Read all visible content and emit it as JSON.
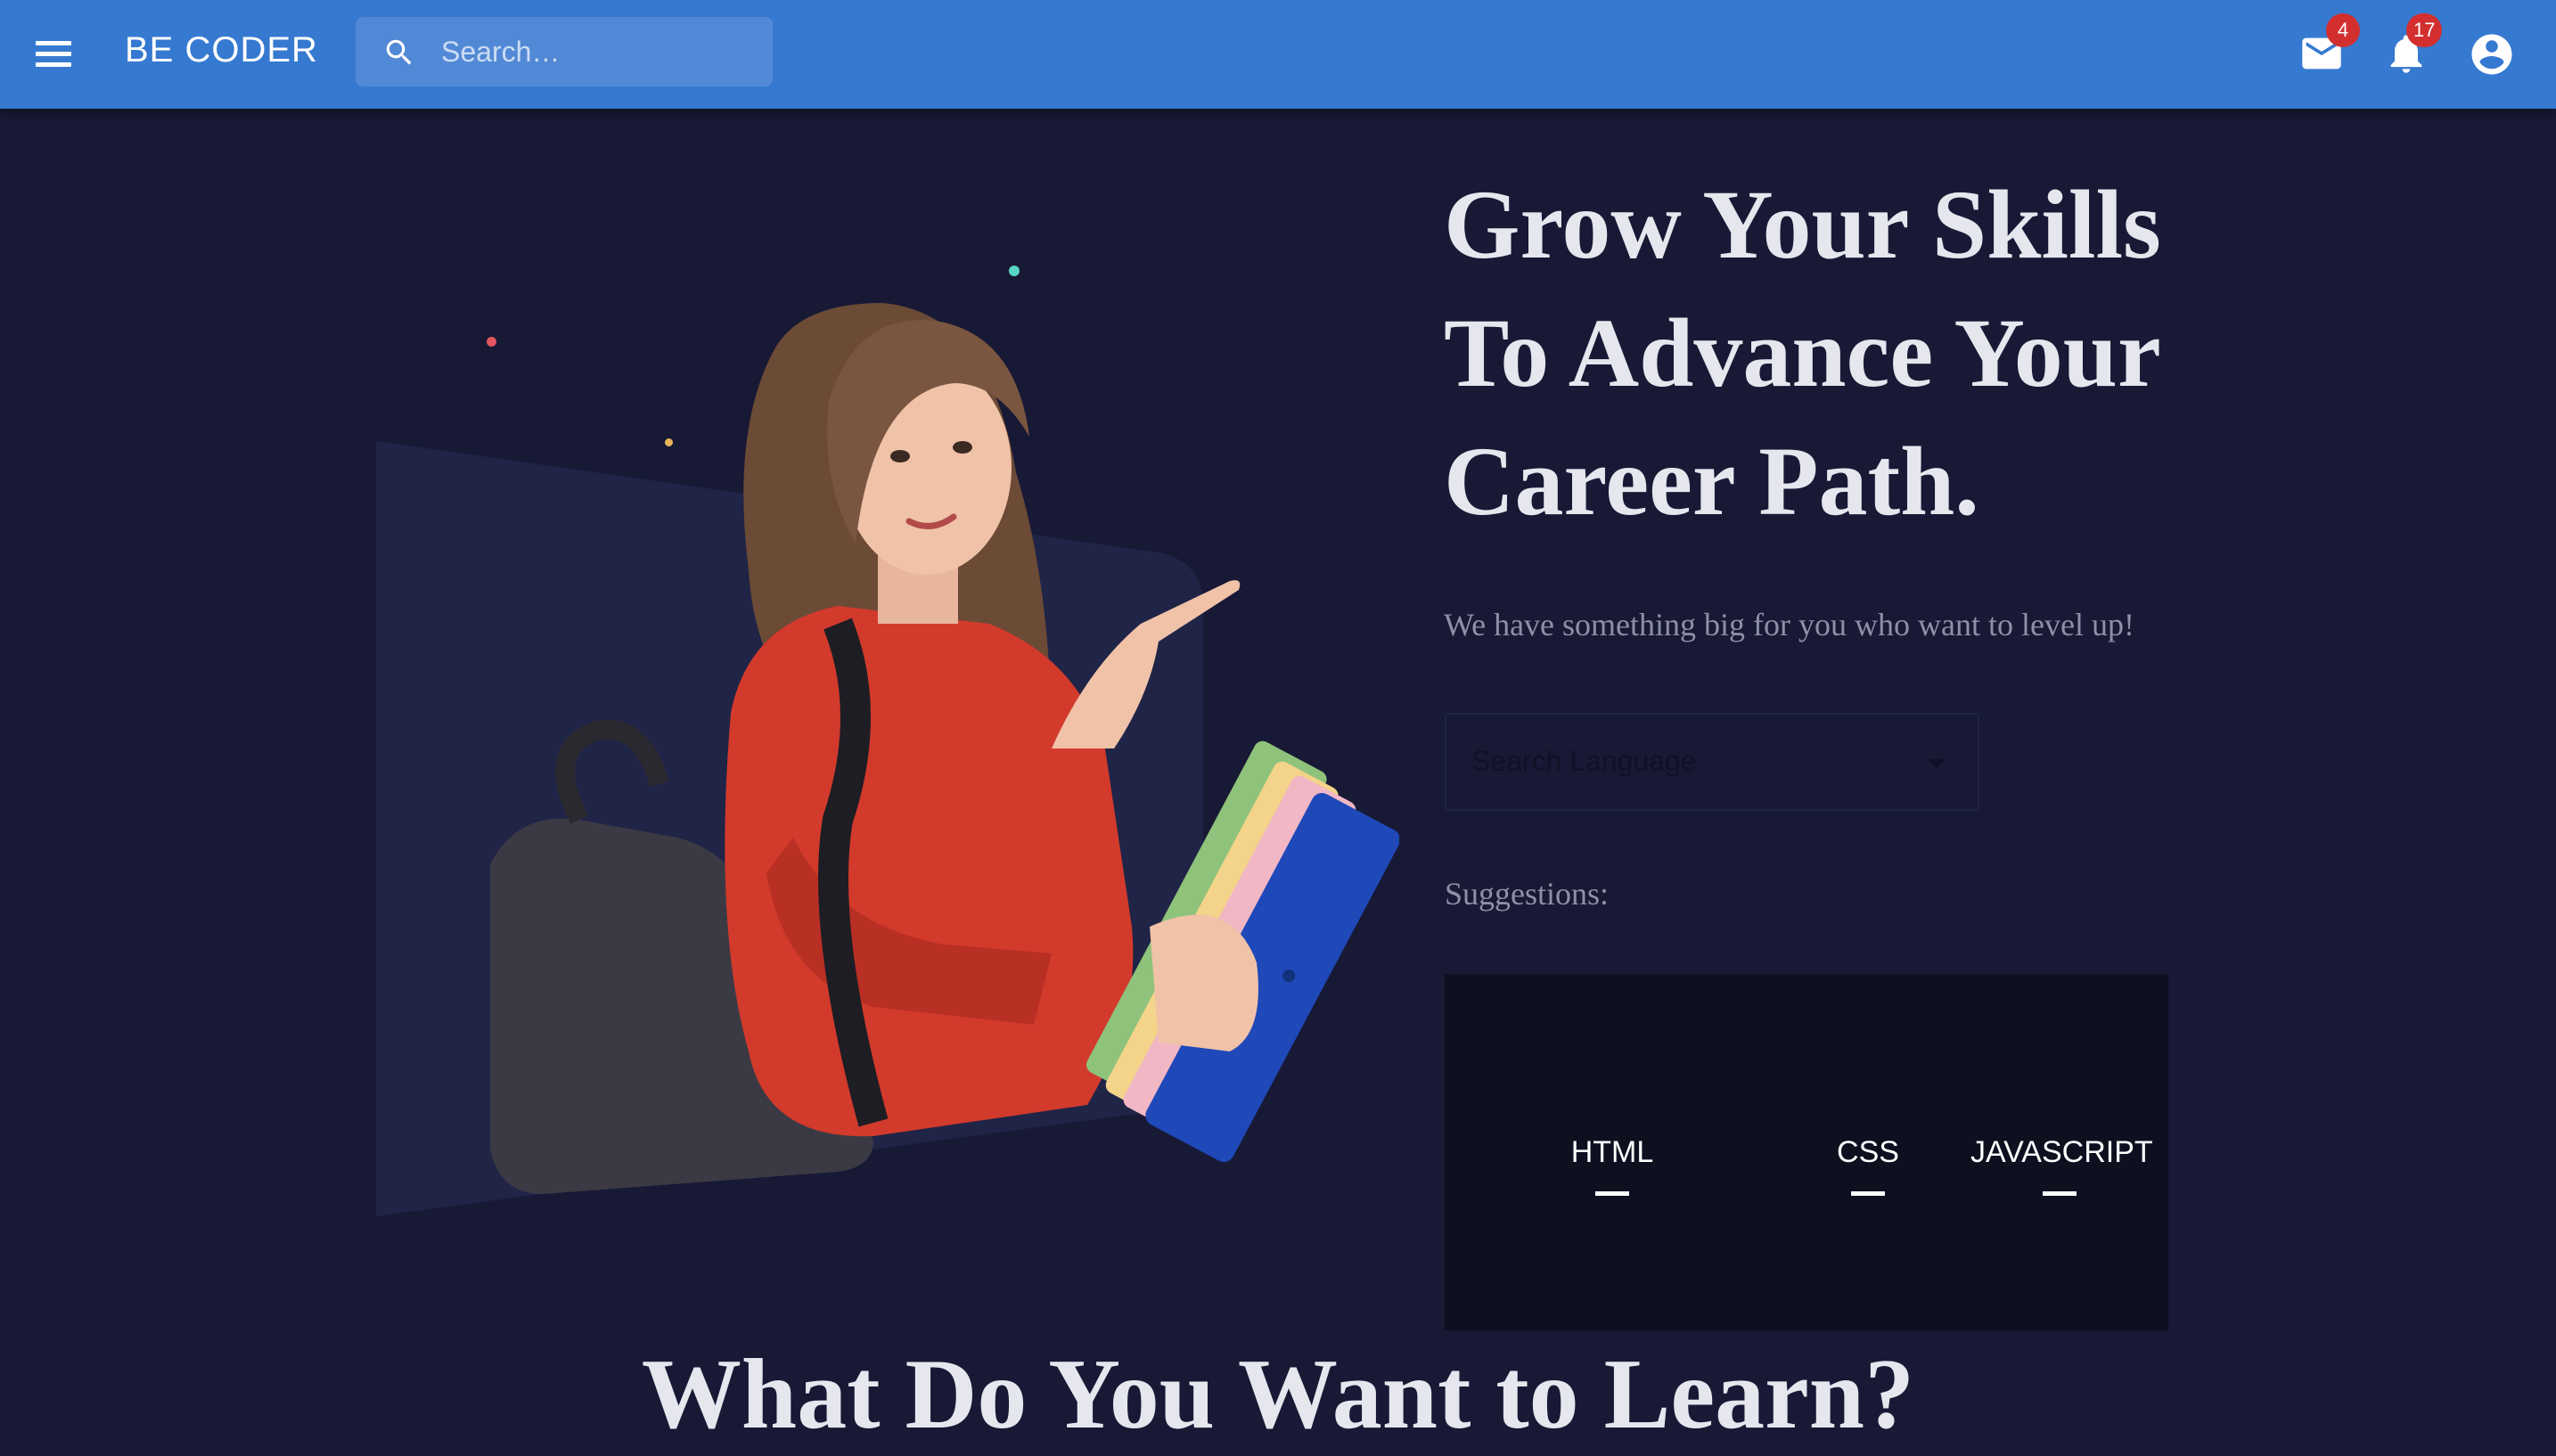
{
  "app": {
    "brand": "BE CODER"
  },
  "search": {
    "placeholder": "Search…"
  },
  "header": {
    "mail_count": "4",
    "notification_count": "17"
  },
  "hero": {
    "headline_lines": [
      "Grow Your Skills",
      "To Advance Your",
      "Career Path."
    ],
    "subtitle": "We have something big for you who want to level up!",
    "language_select": {
      "placeholder": "Search Language"
    },
    "suggestions_label": "Suggestions:",
    "suggestions": [
      "HTML",
      "CSS",
      "JAVASCRIPT"
    ]
  },
  "section": {
    "title": "What Do You Want to Learn?"
  },
  "colors": {
    "appbar": "#3679d0",
    "background": "#171935",
    "badge": "#d32f2f",
    "suggestion_panel": "#0e1020"
  }
}
